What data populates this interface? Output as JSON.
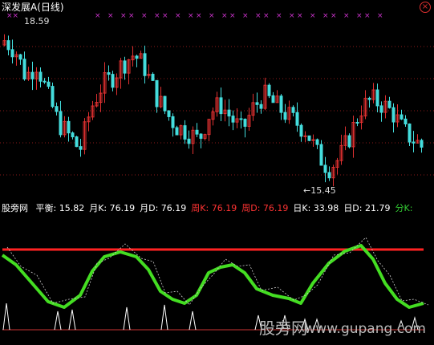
{
  "header": {
    "symbol": "深发展A",
    "period": "(日线)",
    "close_icon": "close-circle-icon"
  },
  "price_chart": {
    "high_label": "18.59",
    "low_label": "←15.45",
    "y_range": [
      15.2,
      18.9
    ],
    "marker_color": "#cc33cc",
    "up_color": "#e03030",
    "down_color": "#44dddd"
  },
  "indicator": {
    "site_label": "股旁网",
    "items": [
      {
        "label": "平衡: 15.82",
        "color": "#ffffff"
      },
      {
        "label": "月K: 76.19",
        "color": "#ffffff"
      },
      {
        "label": "月D: 76.19",
        "color": "#ffffff"
      },
      {
        "label": "周K: 76.19",
        "color": "#ff3333"
      },
      {
        "label": "周D: 76.19",
        "color": "#ff3333"
      },
      {
        "label": "日K: 33.98",
        "color": "#ffffff"
      },
      {
        "label": "日D: 21.79",
        "color": "#ffffff"
      },
      {
        "label": "分K:",
        "color": "#33cc33"
      }
    ],
    "line_color": "#44dd22",
    "level_color": "#ff2222"
  },
  "watermark": {
    "brand": "股旁网",
    "url": "www.gupang.com"
  }
}
